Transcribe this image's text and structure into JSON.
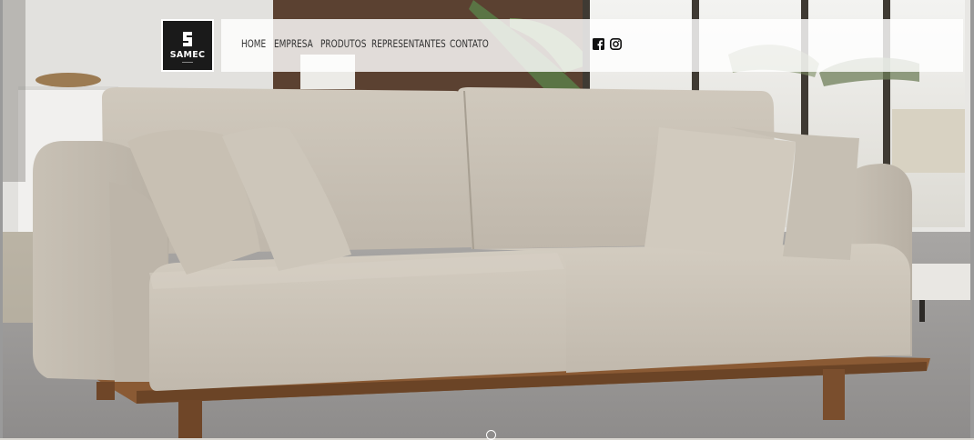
{
  "logo": {
    "text": "SAMEC",
    "icon": "samec-logo-mark"
  },
  "nav": {
    "items": [
      {
        "label": "HOME"
      },
      {
        "label": "EMPRESA"
      },
      {
        "label": "PRODUTOS"
      },
      {
        "label": "REPRESENTANTES"
      },
      {
        "label": "CONTATO"
      }
    ]
  },
  "social": {
    "facebook_icon": "facebook-icon",
    "instagram_icon": "instagram-icon"
  },
  "slider": {
    "dot_icon": "slider-dot"
  },
  "colors": {
    "logo_bg": "#1a1a1a",
    "nav_bg": "#ffffff",
    "nav_text": "#333333",
    "sofa": "#c9c2b6",
    "wood": "#8a5a34"
  }
}
